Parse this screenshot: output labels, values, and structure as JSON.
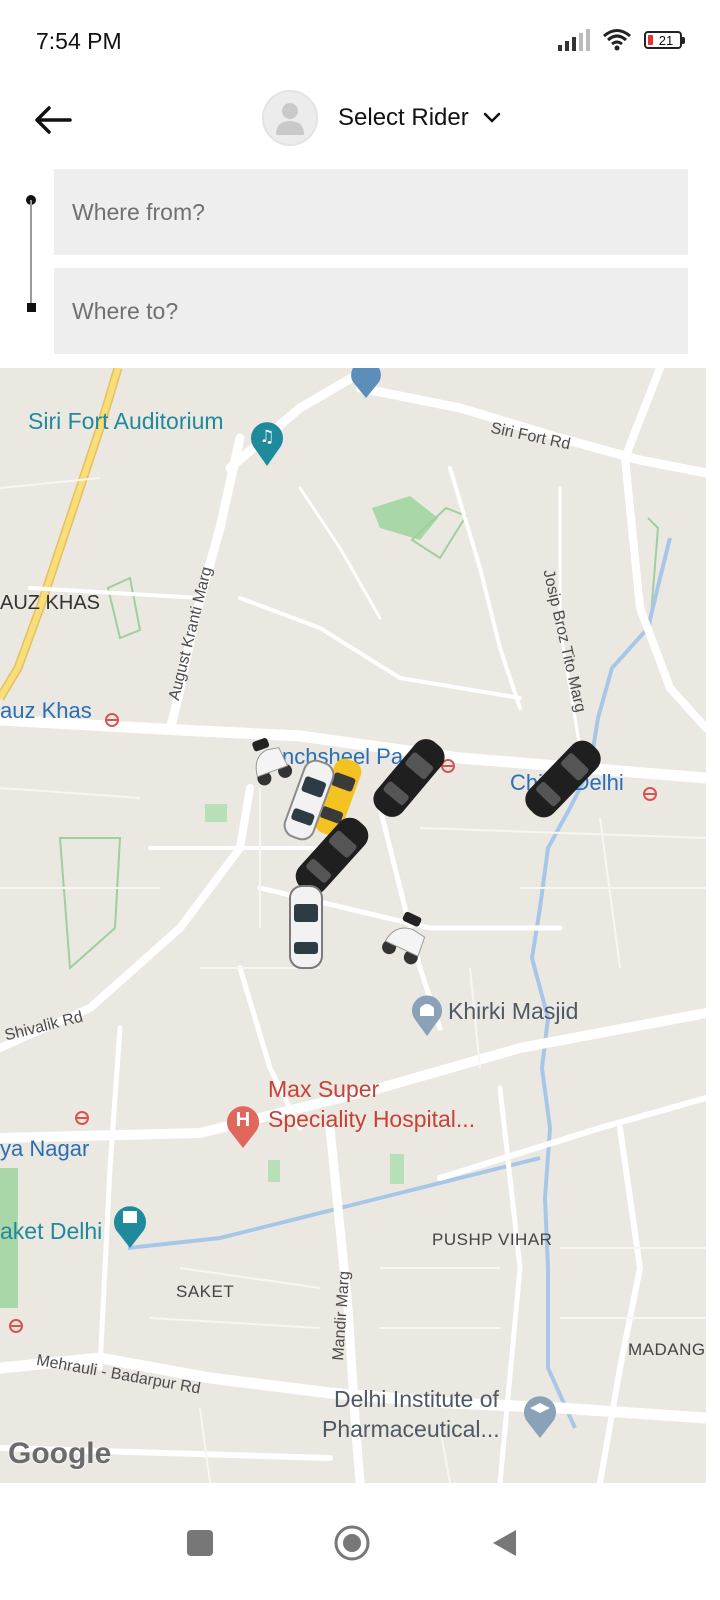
{
  "status_bar": {
    "time": "7:54 PM",
    "battery": "21",
    "icons": [
      "signal-icon",
      "wifi-icon",
      "battery-icon"
    ]
  },
  "header": {
    "back_icon": "arrow-left-icon",
    "rider_label": "Select Rider",
    "rider_icon": "chevron-down-icon"
  },
  "route": {
    "from_placeholder": "Where from?",
    "to_placeholder": "Where to?"
  },
  "map": {
    "labels": {
      "siri_fort_auditorium": "Siri Fort Auditorium",
      "siri_fort_rd": "Siri Fort Rd",
      "josip_broz_tito_marg": "Josip Broz Tito Marg",
      "august_kranti_marg": "August Kranti Marg",
      "hauz_khas_area": "AUZ KHAS",
      "hauz_khas_metro": "auz Khas",
      "panchsheel_park": "nchsheel Pa",
      "chirag_delhi": "Chi     Delhi",
      "khirki_masjid": "Khirki Masjid",
      "shivalik_rd": "Shivalik Rd",
      "max_hospital_1": "Max Super",
      "max_hospital_2": "Speciality Hospital...",
      "malviya_nagar": "ya Nagar",
      "saket_delhi": "aket Delhi",
      "pushp_vihar": "PUSHP VIHAR",
      "saket": "SAKET",
      "mandir_marg": "Mandir Marg",
      "madangir": "MADANGI",
      "mehrauli_rd": "Mehrauli - Badarpur Rd",
      "dipsar_1": "Delhi Institute of",
      "dipsar_2": "Pharmaceutical...",
      "google": "Google"
    },
    "colors": {
      "land": "#ebe8e2",
      "road": "#ffffff",
      "highway": "#f2cf63",
      "water": "#a8c7e8",
      "park": "#c8e3c8",
      "teal_poi": "#1f8a9c",
      "hospital": "#c64236"
    }
  },
  "nav": {
    "recents_icon": "square-icon",
    "home_icon": "circle-home-icon",
    "back_icon": "triangle-back-icon"
  }
}
